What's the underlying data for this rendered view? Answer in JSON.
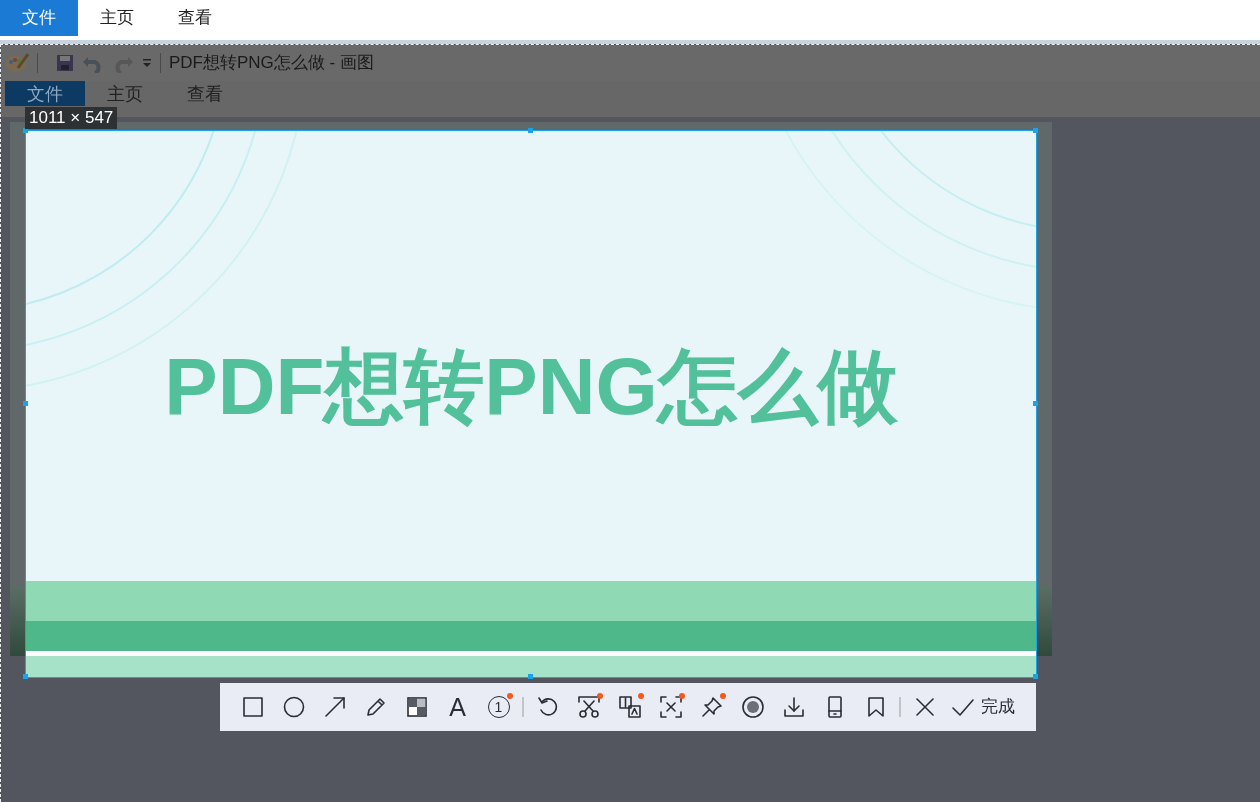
{
  "app_tabs": [
    {
      "label": "文件",
      "selected": true
    },
    {
      "label": "主页",
      "selected": false
    },
    {
      "label": "查看",
      "selected": false
    }
  ],
  "paint_window": {
    "title": "PDF想转PNG怎么做 - 画图",
    "ribbon_tabs": [
      {
        "label": "文件",
        "selected": true
      },
      {
        "label": "主页",
        "selected": false
      },
      {
        "label": "查看",
        "selected": false
      }
    ]
  },
  "selection": {
    "size": "1011 × 547",
    "heading": "PDF想转PNG怎么做"
  },
  "toolbar": {
    "tools": [
      {
        "kind": "rectangle",
        "badge": false
      },
      {
        "kind": "ellipse",
        "badge": false
      },
      {
        "kind": "arrow",
        "badge": false
      },
      {
        "kind": "pencil",
        "badge": false
      },
      {
        "kind": "mosaic",
        "badge": false
      },
      {
        "kind": "text",
        "glyph": "A",
        "badge": false
      },
      {
        "kind": "number",
        "glyph": "1",
        "badge": true
      },
      {
        "kind": "separator"
      },
      {
        "kind": "undo",
        "badge": false
      },
      {
        "kind": "cut",
        "badge": true
      },
      {
        "kind": "translate",
        "badge": true
      },
      {
        "kind": "scan",
        "badge": true
      },
      {
        "kind": "pin",
        "badge": true
      },
      {
        "kind": "record",
        "badge": false
      },
      {
        "kind": "download",
        "badge": false
      },
      {
        "kind": "device",
        "badge": false
      },
      {
        "kind": "bookmark",
        "badge": false
      },
      {
        "kind": "separator"
      },
      {
        "kind": "close",
        "badge": false
      },
      {
        "kind": "done",
        "label": "完成",
        "badge": false
      }
    ]
  }
}
